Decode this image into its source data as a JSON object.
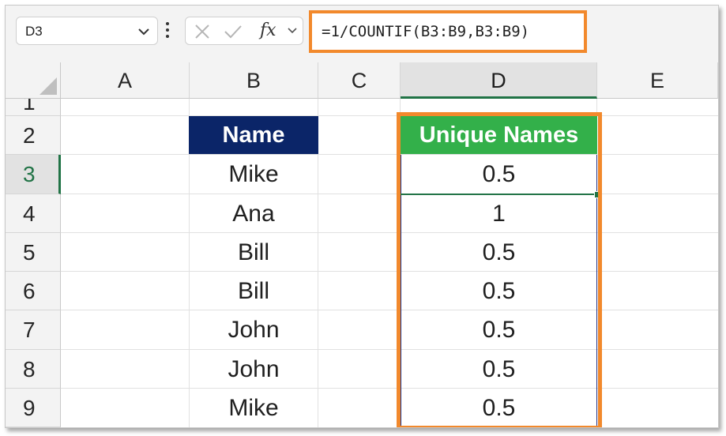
{
  "name_box": {
    "value": "D3"
  },
  "formula_bar": {
    "formula": "=1/COUNTIF(B3:B9,B3:B9)",
    "fx_label": "fx"
  },
  "columns": [
    "A",
    "B",
    "C",
    "D",
    "E"
  ],
  "selected_column": "D",
  "rows": [
    "1",
    "2",
    "3",
    "4",
    "5",
    "6",
    "7",
    "8",
    "9"
  ],
  "selected_row": "3",
  "table": {
    "header_name": "Name",
    "header_unique": "Unique Names",
    "names": [
      "Mike",
      "Ana",
      "Bill",
      "Bill",
      "John",
      "John",
      "Mike"
    ],
    "unique_values": [
      "0.5",
      "1",
      "0.5",
      "0.5",
      "0.5",
      "0.5",
      "0.5"
    ]
  },
  "colors": {
    "highlight_orange": "#f2892c",
    "header_name_bg": "#0b2568",
    "header_unique_bg": "#33b04a",
    "excel_green": "#217346"
  }
}
